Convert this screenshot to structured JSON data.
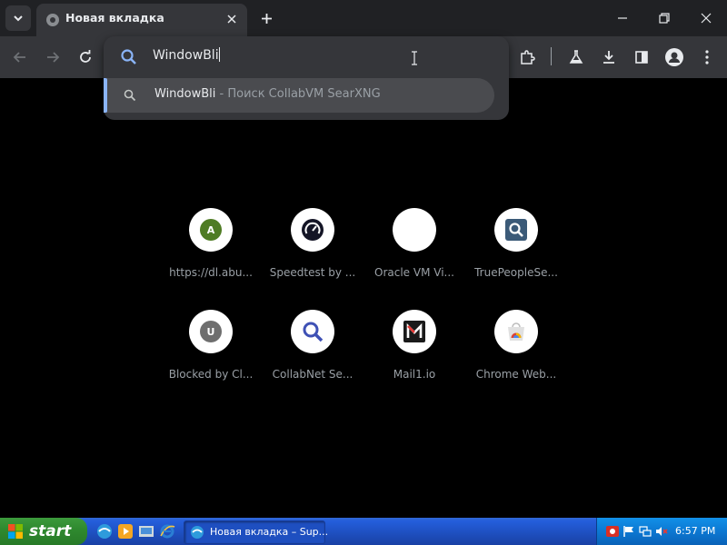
{
  "window": {
    "tab_title": "Новая вкладка"
  },
  "omnibox": {
    "input_value": "WindowBli",
    "suggestion": {
      "main_text": "WindowBli",
      "separator": " - ",
      "description": "Поиск CollabVM SearXNG"
    }
  },
  "shortcuts": [
    {
      "label": "https://dl.abu...",
      "icon": "letter-a-icon",
      "letter": "A",
      "color": "#4f7c24"
    },
    {
      "label": "Speedtest by ...",
      "icon": "speedtest-icon",
      "letter": "",
      "color": "#141526"
    },
    {
      "label": "Oracle VM Vi...",
      "icon": "blank-icon",
      "letter": "",
      "color": "#ffffff"
    },
    {
      "label": "TruePeopleSe...",
      "icon": "truepeoplesearch-icon",
      "letter": "",
      "color": "#3b5a78"
    },
    {
      "label": "Blocked by Cl...",
      "icon": "letter-u-icon",
      "letter": "U",
      "color": "#6e6e6e"
    },
    {
      "label": "CollabNet Se...",
      "icon": "magnifier-icon",
      "letter": "",
      "color": "#3f51b5"
    },
    {
      "label": "Mail1.io",
      "icon": "mail1-icon",
      "letter": "",
      "color": "#1a1a1a"
    },
    {
      "label": "Chrome Web...",
      "icon": "chrome-web-store-icon",
      "letter": "",
      "color": "#e8e8e8"
    }
  ],
  "taskbar": {
    "start_label": "start",
    "task_label": "Новая вкладка – Sup...",
    "clock": "6:57 PM"
  },
  "colors": {
    "titlebar": "#202124",
    "toolbar": "#35363a",
    "accent": "#8ab4f8",
    "page": "#000000"
  }
}
